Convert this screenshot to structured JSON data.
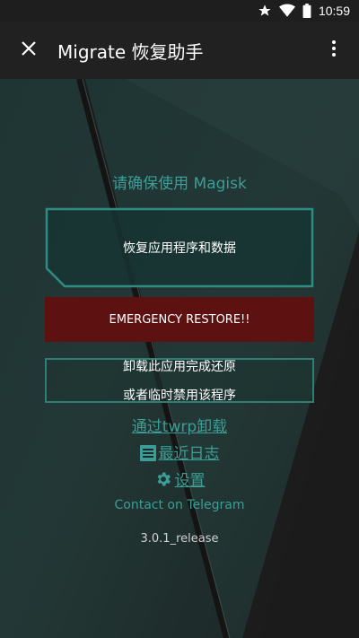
{
  "status_bar": {
    "time": "10:59",
    "icons": [
      "star-icon",
      "wifi-icon",
      "battery-icon"
    ]
  },
  "toolbar": {
    "title": "Migrate 恢复助手",
    "close_icon": "close-icon",
    "more_icon": "more-vert-icon"
  },
  "main": {
    "notice": "请确保使用 Magisk",
    "restore_button": "恢复应用程序和数据",
    "emergency_button": "EMERGENCY RESTORE!!",
    "uninstall_line1": "卸载此应用完成还原",
    "uninstall_line2": "或者临时禁用该程序",
    "twrp_link": "通过twrp卸载",
    "logs_link": "最近日志",
    "settings_link": "设置",
    "telegram_link": "Contact on Telegram",
    "version": "3.0.1_release"
  },
  "colors": {
    "accent": "#3a9e96",
    "emergency": "#5e1111",
    "toolbar": "#212121"
  }
}
